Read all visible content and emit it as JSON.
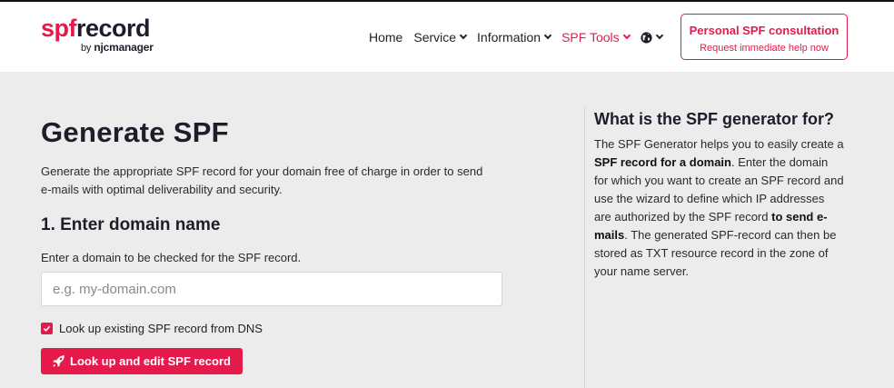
{
  "header": {
    "logo_prefix": "spf",
    "logo_main": "record",
    "logo_by": "by",
    "logo_company": "njcmanager"
  },
  "nav": {
    "items": [
      {
        "label": "Home"
      },
      {
        "label": "Service"
      },
      {
        "label": "Information"
      },
      {
        "label": "SPF Tools"
      }
    ]
  },
  "cta": {
    "title": "Personal SPF consultation",
    "subtitle": "Request immediate help now"
  },
  "main": {
    "title": "Generate SPF",
    "intro": "Generate the appropriate SPF record for your domain free of charge in order to send e-mails with optimal deliverability and security.",
    "step_heading": "1. Enter domain name",
    "field_label": "Enter a domain to be checked for the SPF record.",
    "input_placeholder": "e.g. my-domain.com",
    "input_value": "",
    "checkbox_label": "Look up existing SPF record from DNS",
    "checkbox_checked": true,
    "button_label": "Look up and edit SPF record"
  },
  "aside": {
    "heading": "What is the SPF generator for?",
    "p1": "The SPF Generator helps you to easily create a",
    "b1": "SPF record for a domain",
    "p2": ". Enter the domain for which you want to create an SPF record and use the wizard to define which IP addresses are authorized by the SPF record",
    "b2": "to send e-mails",
    "p3": ". The generated SPF-record can then be stored as TXT resource record in the zone of your name server."
  },
  "colors": {
    "accent": "#e6194b",
    "page_bg": "#ececec",
    "text": "#1e1e2a"
  },
  "icons": [
    "chevron-down-icon",
    "globe-icon",
    "rocket-icon",
    "checkmark-icon"
  ]
}
